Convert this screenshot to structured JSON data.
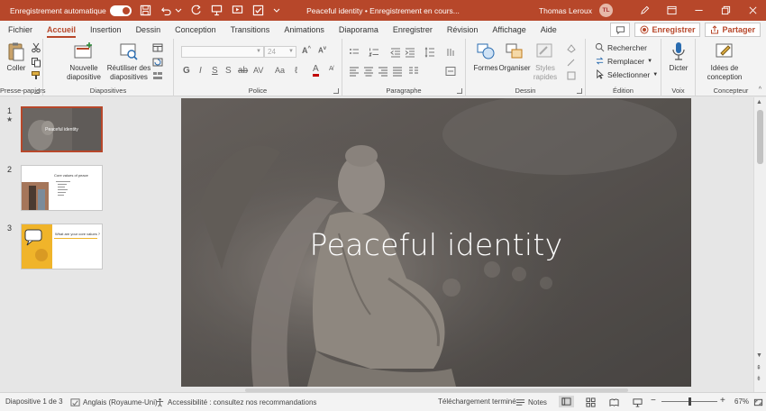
{
  "titlebar": {
    "autosave_label": "Enregistrement automatique",
    "title": "Peaceful identity • Enregistrement en cours...",
    "user_name": "Thomas Leroux",
    "user_initials": "TL"
  },
  "tabs": [
    "Fichier",
    "Accueil",
    "Insertion",
    "Dessin",
    "Conception",
    "Transitions",
    "Animations",
    "Diaporama",
    "Enregistrer",
    "Révision",
    "Affichage",
    "Aide"
  ],
  "active_tab": "Accueil",
  "tab_actions": {
    "record_label": "Enregistrer",
    "share_label": "Partager"
  },
  "ribbon": {
    "clipboard": {
      "paste": "Coller",
      "label": "Presse-papiers"
    },
    "slides": {
      "new_slide_1": "Nouvelle",
      "new_slide_2": "diapositive",
      "reuse_1": "Réutiliser des",
      "reuse_2": "diapositives",
      "label": "Diapositives"
    },
    "font": {
      "font_size": "24",
      "label": "Police"
    },
    "paragraph": {
      "label": "Paragraphe"
    },
    "drawing": {
      "shapes": "Formes",
      "arrange": "Organiser",
      "styles_1": "Styles",
      "styles_2": "rapides",
      "label": "Dessin"
    },
    "editing": {
      "find": "Rechercher",
      "replace": "Remplacer",
      "select": "Sélectionner",
      "label": "Édition"
    },
    "voice": {
      "dictate": "Dicter",
      "label": "Voix"
    },
    "designer": {
      "ideas_1": "Idées de",
      "ideas_2": "conception",
      "label": "Concepteur"
    }
  },
  "slides": [
    {
      "number": "1",
      "title": "Peaceful identity",
      "has_star": true
    },
    {
      "number": "2",
      "title": "Core values of peace"
    },
    {
      "number": "3",
      "title": "What are your core values ?"
    }
  ],
  "current_slide": {
    "title": "Peaceful identity"
  },
  "statusbar": {
    "slide_info": "Diapositive 1 de 3",
    "language": "Anglais (Royaume-Uni)",
    "accessibility": "Accessibilité : consultez nos recommandations",
    "upload_status": "Téléchargement terminé",
    "notes": "Notes",
    "zoom": "67%"
  },
  "colors": {
    "accent": "#b7472a",
    "slide_bg": "#5a5652"
  }
}
